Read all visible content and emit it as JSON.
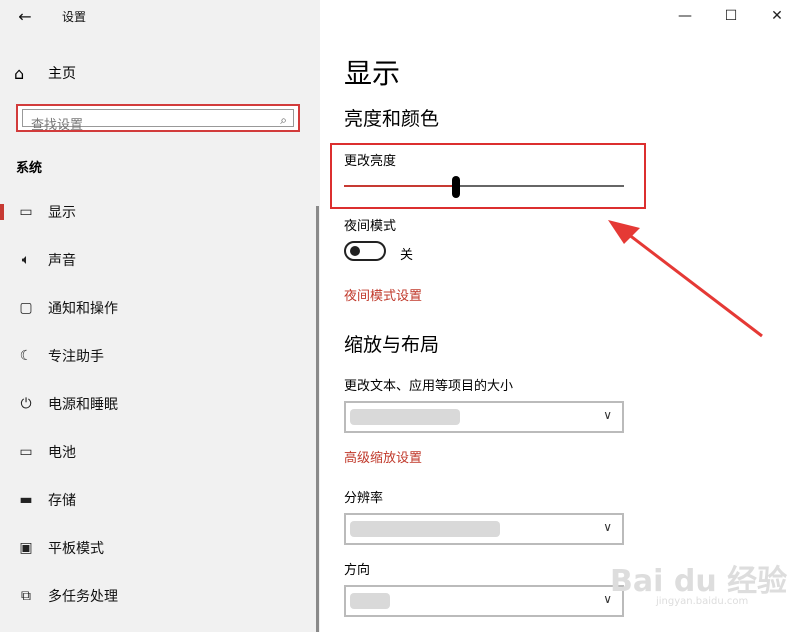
{
  "app": {
    "title": "设置",
    "back_icon": "arrow-left-icon"
  },
  "window_controls": {
    "minimize": "—",
    "maximize": "☐",
    "close": "✕"
  },
  "sidebar": {
    "home_label": "主页",
    "search_placeholder": "查找设置",
    "section_label": "系统",
    "items": [
      {
        "label": "显示",
        "icon": "monitor-icon",
        "active": true
      },
      {
        "label": "声音",
        "icon": "speaker-icon"
      },
      {
        "label": "通知和操作",
        "icon": "notification-icon"
      },
      {
        "label": "专注助手",
        "icon": "moon-icon"
      },
      {
        "label": "电源和睡眠",
        "icon": "power-icon"
      },
      {
        "label": "电池",
        "icon": "battery-icon"
      },
      {
        "label": "存储",
        "icon": "storage-icon"
      },
      {
        "label": "平板模式",
        "icon": "tablet-icon"
      },
      {
        "label": "多任务处理",
        "icon": "multitask-icon"
      }
    ]
  },
  "main": {
    "title": "显示",
    "brightness_section": "亮度和颜色",
    "brightness_label": "更改亮度",
    "brightness_value": 40,
    "night_mode_label": "夜间模式",
    "night_mode_state": "关",
    "night_mode_link": "夜间模式设置",
    "scale_section": "缩放与布局",
    "text_size_label": "更改文本、应用等项目的大小",
    "advanced_scaling_link": "高级缩放设置",
    "resolution_label": "分辨率",
    "orientation_label": "方向"
  },
  "colors": {
    "accent": "#c73a33",
    "highlight": "#dc2f2f"
  },
  "watermark": {
    "text": "Bai du 经验",
    "sub": "jingyan.baidu.com"
  }
}
